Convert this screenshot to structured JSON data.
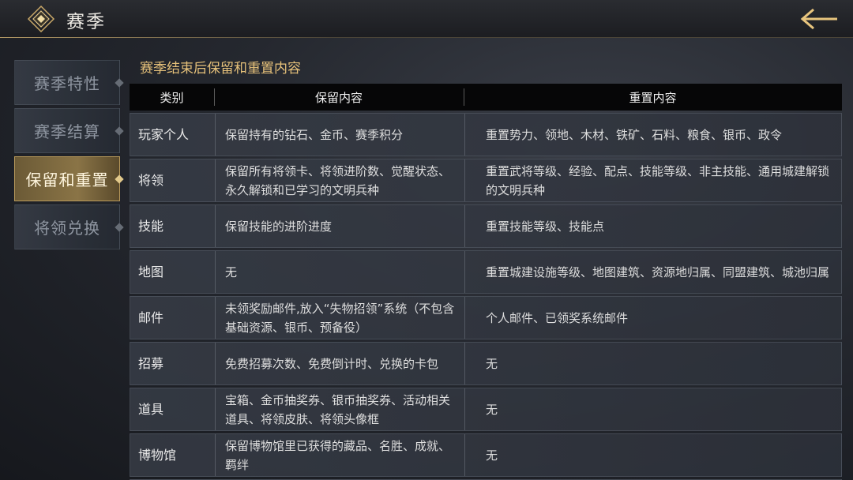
{
  "header": {
    "title": "赛季",
    "back_icon": "back-arrow-icon"
  },
  "sidebar": {
    "items": [
      {
        "label": "赛季特性",
        "active": false
      },
      {
        "label": "赛季结算",
        "active": false
      },
      {
        "label": "保留和重置",
        "active": true
      },
      {
        "label": "将领兑换",
        "active": false
      }
    ]
  },
  "main": {
    "section_title": "赛季结束后保留和重置内容",
    "table": {
      "headers": [
        "类别",
        "保留内容",
        "重置内容"
      ],
      "rows": [
        {
          "category": "玩家个人",
          "keep": "保留持有的钻石、金币、赛季积分",
          "reset": "重置势力、领地、木材、铁矿、石料、粮食、银币、政令"
        },
        {
          "category": "将领",
          "keep": "保留所有将领卡、将领进阶数、觉醒状态、永久解锁和已学习的文明兵种",
          "reset": "重置武将等级、经验、配点、技能等级、非主技能、通用城建解锁的文明兵种"
        },
        {
          "category": "技能",
          "keep": "保留技能的进阶进度",
          "reset": "重置技能等级、技能点"
        },
        {
          "category": "地图",
          "keep": "无",
          "reset": "重置城建设施等级、地图建筑、资源地归属、同盟建筑、城池归属"
        },
        {
          "category": "邮件",
          "keep": "未领奖励邮件,放入“失物招领”系统（不包含基础资源、银币、预备役）",
          "reset": "个人邮件、已领奖系统邮件"
        },
        {
          "category": "招募",
          "keep": "免费招募次数、免费倒计时、兑换的卡包",
          "reset": "无"
        },
        {
          "category": "道具",
          "keep": "宝箱、金币抽奖券、银币抽奖券、活动相关道具、将领皮肤、将领头像框",
          "reset": "无"
        },
        {
          "category": "博物馆",
          "keep": "保留博物馆里已获得的藏品、名胜、成就、羁绊",
          "reset": "无"
        }
      ]
    }
  },
  "colors": {
    "accent_gold": "#e6c17a",
    "active_tab": "#8a7446",
    "header_bg": "#060607"
  }
}
